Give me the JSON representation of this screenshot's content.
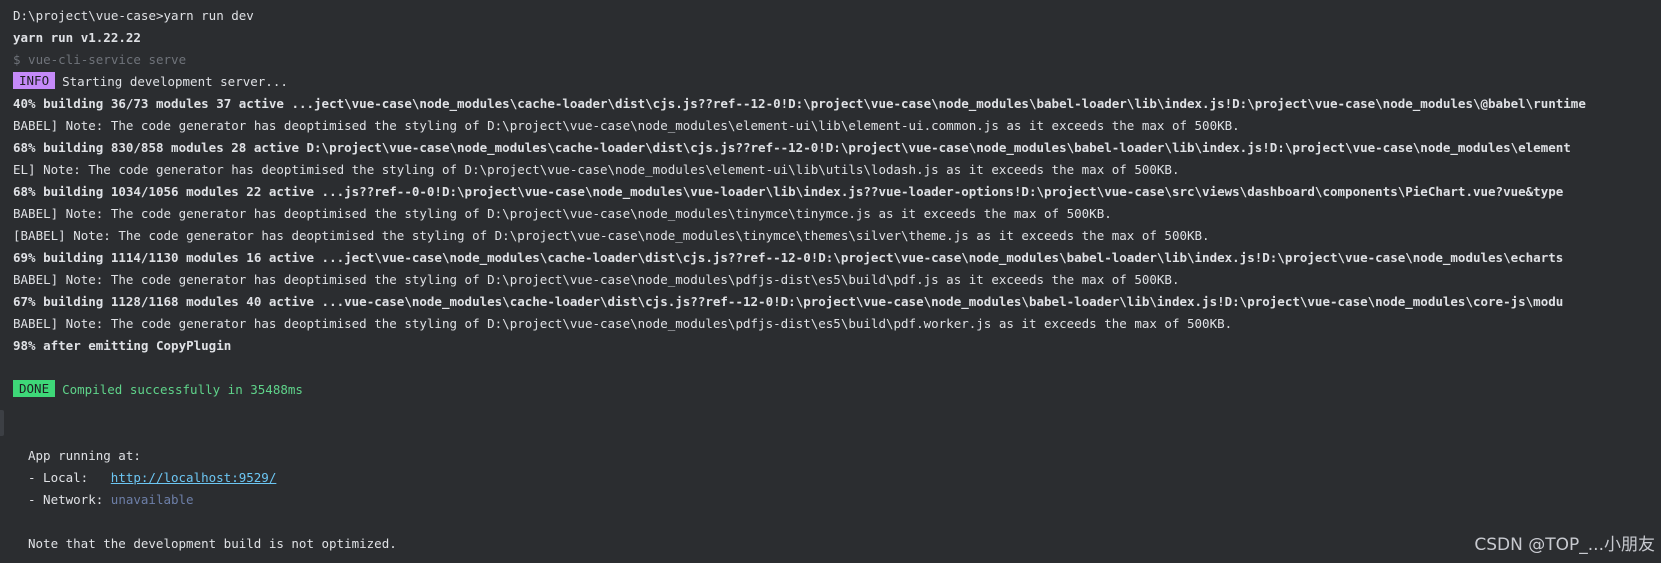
{
  "terminal": {
    "cmd_prompt": "D:\\project\\vue-case>yarn run dev",
    "yarn_version": "yarn run v1.22.22",
    "serve_cmd": "$ vue-cli-service serve",
    "info_tag": "INFO",
    "info_text": "Starting development server...",
    "log": [
      {
        "text": "40% building 36/73 modules 37 active ...ject\\vue-case\\node_modules\\cache-loader\\dist\\cjs.js??ref--12-0!D:\\project\\vue-case\\node_modules\\babel-loader\\lib\\index.js!D:\\project\\vue-case\\node_modules\\@babel\\runtime",
        "bold": true
      },
      {
        "text": "BABEL] Note: The code generator has deoptimised the styling of D:\\project\\vue-case\\node_modules\\element-ui\\lib\\element-ui.common.js as it exceeds the max of 500KB.",
        "bold": false
      },
      {
        "text": "68% building 830/858 modules 28 active D:\\project\\vue-case\\node_modules\\cache-loader\\dist\\cjs.js??ref--12-0!D:\\project\\vue-case\\node_modules\\babel-loader\\lib\\index.js!D:\\project\\vue-case\\node_modules\\element",
        "bold": true
      },
      {
        "text": "EL] Note: The code generator has deoptimised the styling of D:\\project\\vue-case\\node_modules\\element-ui\\lib\\utils\\lodash.js as it exceeds the max of 500KB.",
        "bold": false
      },
      {
        "text": "68% building 1034/1056 modules 22 active ...js??ref--0-0!D:\\project\\vue-case\\node_modules\\vue-loader\\lib\\index.js??vue-loader-options!D:\\project\\vue-case\\src\\views\\dashboard\\components\\PieChart.vue?vue&type",
        "bold": true
      },
      {
        "text": "BABEL] Note: The code generator has deoptimised the styling of D:\\project\\vue-case\\node_modules\\tinymce\\tinymce.js as it exceeds the max of 500KB.",
        "bold": false
      },
      {
        "text": "[BABEL] Note: The code generator has deoptimised the styling of D:\\project\\vue-case\\node_modules\\tinymce\\themes\\silver\\theme.js as it exceeds the max of 500KB.",
        "bold": false
      },
      {
        "text": "69% building 1114/1130 modules 16 active ...ject\\vue-case\\node_modules\\cache-loader\\dist\\cjs.js??ref--12-0!D:\\project\\vue-case\\node_modules\\babel-loader\\lib\\index.js!D:\\project\\vue-case\\node_modules\\echarts",
        "bold": true
      },
      {
        "text": "BABEL] Note: The code generator has deoptimised the styling of D:\\project\\vue-case\\node_modules\\pdfjs-dist\\es5\\build\\pdf.js as it exceeds the max of 500KB.",
        "bold": false
      },
      {
        "text": "67% building 1128/1168 modules 40 active ...vue-case\\node_modules\\cache-loader\\dist\\cjs.js??ref--12-0!D:\\project\\vue-case\\node_modules\\babel-loader\\lib\\index.js!D:\\project\\vue-case\\node_modules\\core-js\\modu",
        "bold": true
      },
      {
        "text": "BABEL] Note: The code generator has deoptimised the styling of D:\\project\\vue-case\\node_modules\\pdfjs-dist\\es5\\build\\pdf.worker.js as it exceeds the max of 500KB.",
        "bold": false
      },
      {
        "text": "98% after emitting CopyPlugin",
        "bold": true
      }
    ],
    "done_tag": "DONE",
    "done_text": "Compiled successfully in 35488ms",
    "app_running": "App running at:",
    "local_label": "- Local:   ",
    "local_url": "http://localhost:9529/",
    "network_label": "- Network: ",
    "network_value": "unavailable",
    "note": "Note that the development build is not optimized."
  },
  "watermark": "CSDN @TOP_...小朋友",
  "colors": {
    "background": "#2b2d30",
    "info_tag": "#c58af9",
    "done_tag": "#3ed778",
    "success_text": "#5fd38a",
    "link": "#6cc6f3"
  }
}
